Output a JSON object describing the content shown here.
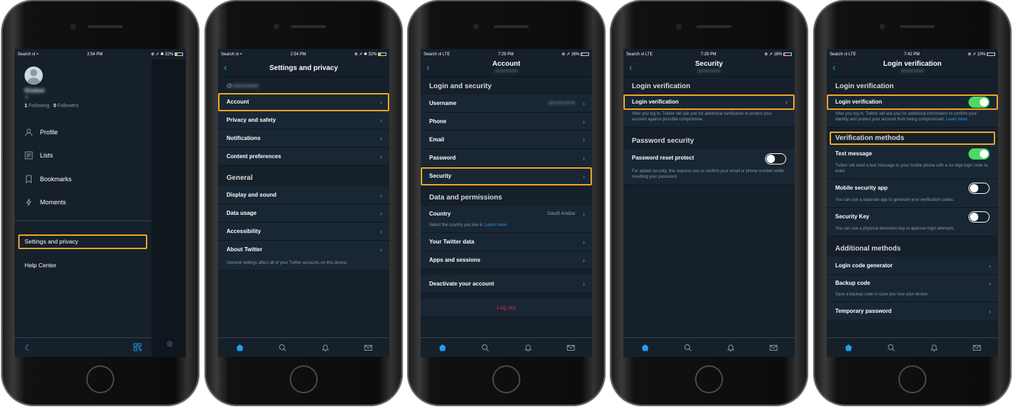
{
  "colors": {
    "accent": "#1da1f2",
    "highlight": "#f5a623",
    "toggle_on": "#4cd964",
    "logout": "#e0245e",
    "bg": "#15202b",
    "row_bg": "#192734"
  },
  "phone1": {
    "status": {
      "left": "Search",
      "time": "2:54 PM",
      "right": "32%"
    },
    "user": {
      "name": "Khaleel",
      "handle": "@",
      "following_count": "1",
      "following_label": "Following",
      "followers_count": "0",
      "followers_label": "Followers"
    },
    "menu": [
      {
        "label": "Profile",
        "icon": "person-icon"
      },
      {
        "label": "Lists",
        "icon": "list-icon"
      },
      {
        "label": "Bookmarks",
        "icon": "bookmark-icon"
      },
      {
        "label": "Moments",
        "icon": "lightning-icon"
      }
    ],
    "settings_label": "Settings and privacy",
    "help_label": "Help Center",
    "bottom_icons": [
      "moon-icon",
      "qr-code-icon"
    ]
  },
  "phone2": {
    "status": {
      "left": "Search",
      "time": "2:54 PM",
      "right": "32%"
    },
    "title": "Settings and privacy",
    "handle": "@",
    "rows1": [
      "Account",
      "Privacy and safety",
      "Notifications",
      "Content preferences"
    ],
    "section_general": "General",
    "rows2": [
      "Display and sound",
      "Data usage",
      "Accessibility",
      "About Twitter"
    ],
    "footer": "General settings affect all of your Twitter accounts on this device."
  },
  "phone3": {
    "status": {
      "left": "Search",
      "net": "LTE",
      "time": "7:29 PM",
      "right": "16%"
    },
    "title": "Account",
    "subtitle": "@",
    "section_login": "Login and security",
    "username_label": "Username",
    "username_value": "@",
    "phone_label": "Phone",
    "phone_value": "",
    "email_label": "Email",
    "email_value": "",
    "password_label": "Password",
    "security_label": "Security",
    "section_data": "Data and permissions",
    "country_label": "Country",
    "country_value": "Saudi Arabia",
    "country_desc": "Select the country you live in.",
    "learn_more": "Learn more",
    "twitter_data": "Your Twitter data",
    "apps_sessions": "Apps and sessions",
    "deactivate": "Deactivate your account",
    "logout": "Log out"
  },
  "phone4": {
    "status": {
      "left": "Search",
      "net": "LTE",
      "time": "7:29 PM",
      "right": "16%"
    },
    "title": "Security",
    "subtitle": "@",
    "section_login": "Login verification",
    "login_row": "Login verification",
    "login_desc": "After you log in, Twitter will ask you for additional verification to protect your account against possible compromise.",
    "section_password": "Password security",
    "reset_row": "Password reset protect",
    "reset_toggle_on": false,
    "reset_desc": "For added security, this requires you to confirm your email or phone number while resetting your password."
  },
  "phone5": {
    "status": {
      "left": "Search",
      "net": "LTE",
      "time": "7:42 PM",
      "right": "10%"
    },
    "title": "Login verification",
    "subtitle": "@",
    "section_login": "Login verification",
    "login_row": "Login verification",
    "login_toggle_on": true,
    "login_desc": "After you log in, Twitter will ask you for additional information to confirm your identity and protect your account from being compromised.",
    "login_learn": "Learn more",
    "section_methods": "Verification methods",
    "text_msg": "Text message",
    "text_toggle_on": true,
    "text_desc": "Twitter will send a text message to your mobile phone with a six-digit login code to enter.",
    "mobile_app": "Mobile security app",
    "mobile_toggle_on": false,
    "mobile_desc": "You can use a separate app to generate your verification codes.",
    "security_key": "Security Key",
    "key_toggle_on": false,
    "key_desc": "You can use a physical electronic key to approve login attempts.",
    "section_additional": "Additional methods",
    "code_gen": "Login code generator",
    "backup": "Backup code",
    "backup_desc": "Save a backup code in case you lose your device.",
    "temp_pw": "Temporary password"
  },
  "tab_icons": [
    "home-icon",
    "search-icon",
    "bell-icon",
    "mail-icon"
  ]
}
